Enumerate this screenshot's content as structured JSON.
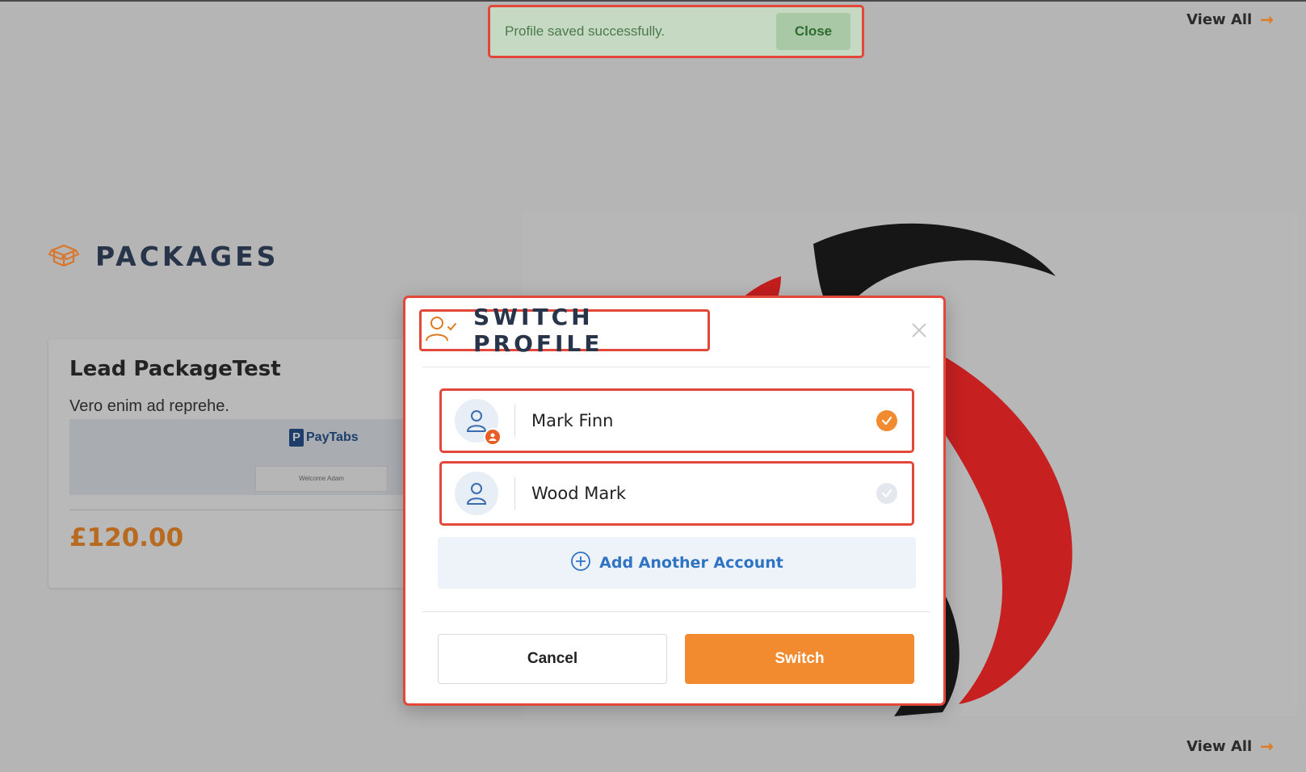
{
  "toast": {
    "message": "Profile saved successfully.",
    "close_label": "Close"
  },
  "links": {
    "view_all_top": "View All",
    "view_all_bottom": "View All"
  },
  "packages": {
    "heading": "PACKAGES",
    "card": {
      "name": "Lead PackageTest",
      "description": "Vero enim ad reprehe.",
      "thumbnail_brand": "PayTabs",
      "thumbnail_welcome": "Welcome Adam",
      "price": "£120.00"
    }
  },
  "modal": {
    "title": "SWITCH PROFILE",
    "accounts": [
      {
        "name": "Mark Finn",
        "selected": true
      },
      {
        "name": "Wood Mark",
        "selected": false
      }
    ],
    "add_account_label": "Add Another Account",
    "cancel_label": "Cancel",
    "switch_label": "Switch"
  },
  "colors": {
    "accent": "#f28a30",
    "highlight_border": "#e2473a",
    "link_blue": "#2e73c4",
    "heading": "#27344a"
  },
  "icons": {
    "packages": "box-icon",
    "modal_title": "user-check-icon",
    "close": "close-icon",
    "account_avatar": "user-icon",
    "selected": "check-circle-icon",
    "add": "plus-circle-icon",
    "view_all": "arrow-right-icon"
  }
}
